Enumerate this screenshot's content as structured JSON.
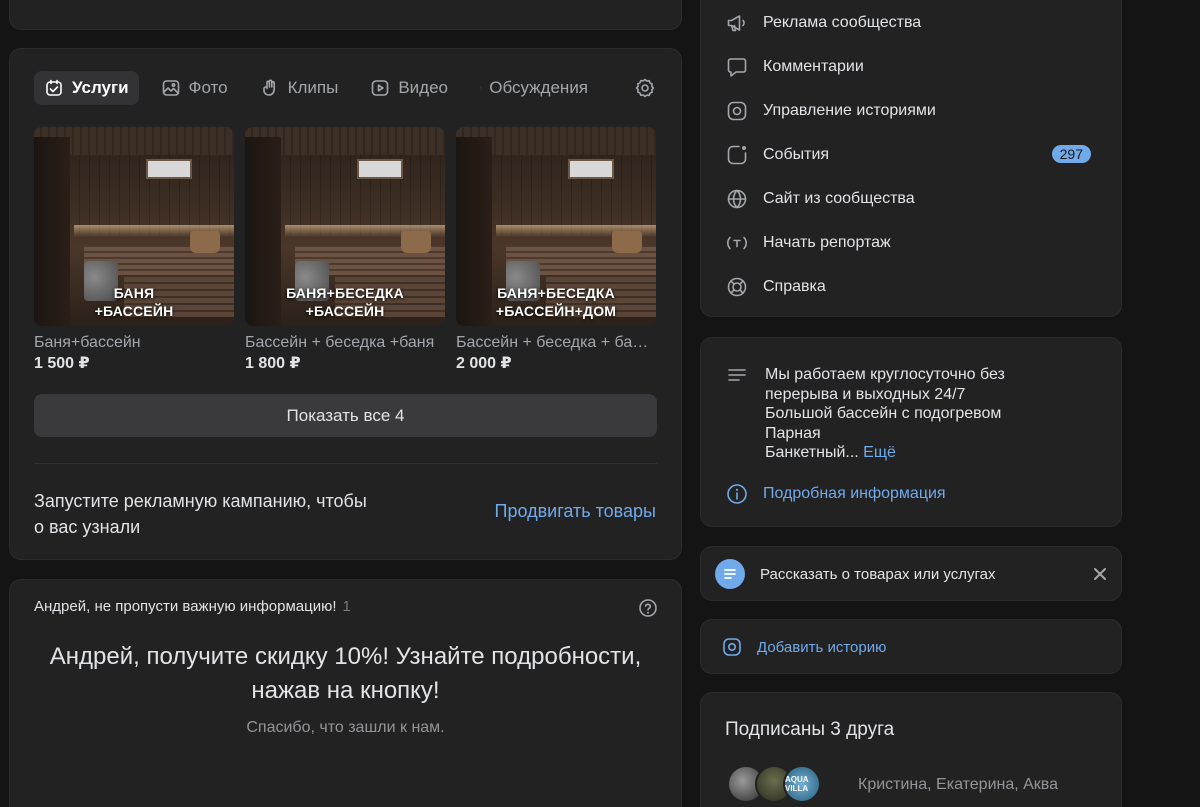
{
  "services": {
    "tabs": [
      {
        "label": "Услуги",
        "icon": "calendar-icon",
        "active": true
      },
      {
        "label": "Фото",
        "icon": "photo-icon"
      },
      {
        "label": "Клипы",
        "icon": "clips-icon"
      },
      {
        "label": "Видео",
        "icon": "video-icon"
      },
      {
        "label": "Обсуждения",
        "icon": "discussion-icon"
      }
    ],
    "items": [
      {
        "caption_line1": "БАНЯ",
        "caption_line2": "+БАССЕЙН",
        "name": "Баня+бассейн",
        "price": "1 500 ₽"
      },
      {
        "caption_line1": "БАНЯ+БЕСЕДКА",
        "caption_line2": "+БАССЕЙН",
        "name": "Бассейн + беседка +баня",
        "price": "1 800 ₽"
      },
      {
        "caption_line1": "БАНЯ+БЕСЕДКА",
        "caption_line2": "+БАССЕЙН+ДОМ",
        "name": "Бассейн + беседка + баня + дом",
        "price": "2 000 ₽"
      }
    ],
    "show_all": "Показать все 4",
    "promo_text": "Запустите рекламную кампанию, чтобы о вас узнали",
    "promo_link": "Продвигать товары"
  },
  "notice": {
    "head": "Андрей, не пропусти важную информацию!",
    "count": "1",
    "title": "Андрей, получите скидку 10%! Узнайте подробности, нажав на кнопку!",
    "subtitle": "Спасибо, что зашли к нам."
  },
  "menu": {
    "items": [
      {
        "label": "Реклама сообщества",
        "icon": "megaphone-icon"
      },
      {
        "label": "Комментарии",
        "icon": "comment-icon"
      },
      {
        "label": "Управление историями",
        "icon": "stories-icon"
      },
      {
        "label": "События",
        "icon": "events-icon",
        "badge": "297"
      },
      {
        "label": "Сайт из сообщества",
        "icon": "globe-icon"
      },
      {
        "label": "Начать репортаж",
        "icon": "broadcast-icon"
      },
      {
        "label": "Справка",
        "icon": "lifebuoy-icon"
      }
    ]
  },
  "info": {
    "text": "Мы работаем круглосуточно без\nперерыва и выходных 24/7\nБольшой бассейн с подогревом\nПарная\nБанкетный...",
    "more": "Ещё",
    "link": "Подробная информация"
  },
  "tell": {
    "text": "Рассказать о товарах или услугах"
  },
  "story": {
    "text": "Добавить историю"
  },
  "friends": {
    "title": "Подписаны 3 друга",
    "names": "Кристина, Екатерина, Аква",
    "avatar3_text": "AQUA VILLA"
  },
  "colors": {
    "accent": "#71aaeb",
    "background": "#141414",
    "card": "#222222"
  }
}
